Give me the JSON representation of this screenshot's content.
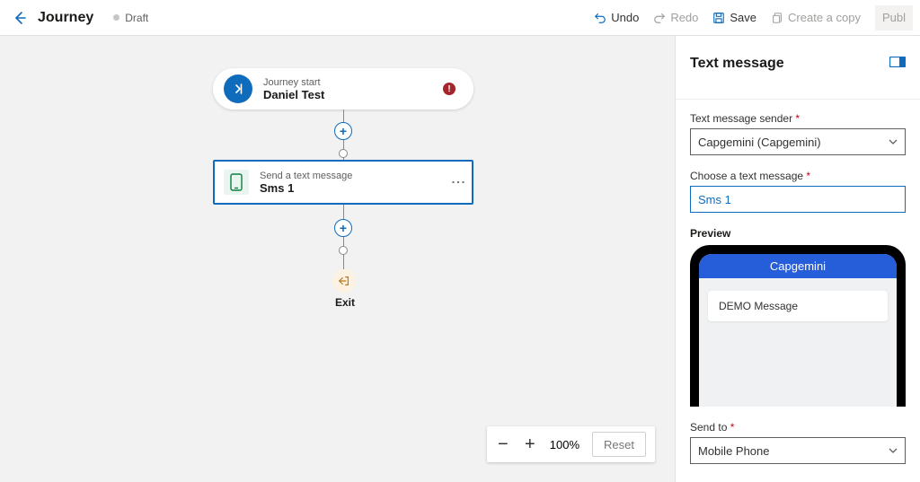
{
  "topbar": {
    "title": "Journey",
    "status": "Draft",
    "undo": "Undo",
    "redo": "Redo",
    "save": "Save",
    "copy": "Create a copy",
    "publish": "Publ"
  },
  "canvas": {
    "start": {
      "caption": "Journey start",
      "name": "Daniel Test"
    },
    "sms": {
      "caption": "Send a text message",
      "name": "Sms 1"
    },
    "exit": {
      "label": "Exit"
    },
    "zoom": {
      "value": "100%",
      "reset": "Reset"
    }
  },
  "side": {
    "title": "Text message",
    "sender": {
      "label": "Text message sender",
      "value": "Capgemini (Capgemini)"
    },
    "choose": {
      "label": "Choose a text message",
      "value": "Sms 1"
    },
    "preview": {
      "label": "Preview",
      "header": "Capgemini",
      "message": "DEMO Message"
    },
    "sendto": {
      "label": "Send to",
      "value": "Mobile Phone"
    }
  }
}
